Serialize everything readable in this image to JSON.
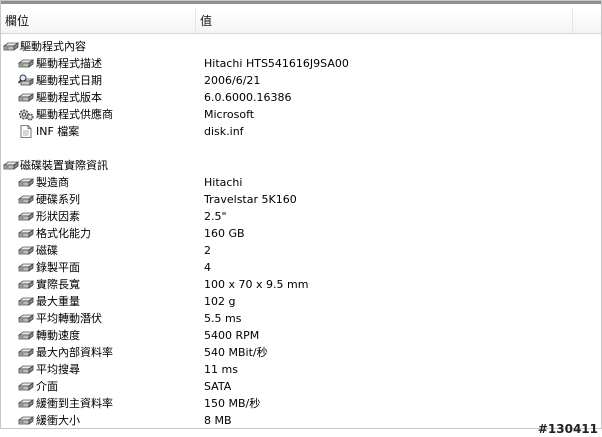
{
  "header": {
    "col_field": "欄位",
    "col_value": "值"
  },
  "sections": [
    {
      "title": "驅動程式內容",
      "icon": "drive-icon",
      "rows": [
        {
          "label": "驅動程式描述",
          "value": "Hitachi HTS541616J9SA00",
          "icon": "drive-icon"
        },
        {
          "label": "驅動程式日期",
          "value": "2006/6/21",
          "icon": "search-drive-icon"
        },
        {
          "label": "驅動程式版本",
          "value": "6.0.6000.16386",
          "icon": "drive-icon"
        },
        {
          "label": "驅動程式供應商",
          "value": "Microsoft",
          "icon": "gear-icon"
        },
        {
          "label": "INF 檔案",
          "value": "disk.inf",
          "icon": "document-icon"
        }
      ]
    },
    {
      "title": "磁碟裝置實際資訊",
      "icon": "drive-icon",
      "rows": [
        {
          "label": "製造商",
          "value": "Hitachi",
          "icon": "drive-icon"
        },
        {
          "label": "硬碟系列",
          "value": "Travelstar 5K160",
          "icon": "drive-icon"
        },
        {
          "label": "形狀因素",
          "value": "2.5\"",
          "icon": "drive-icon"
        },
        {
          "label": "格式化能力",
          "value": "160 GB",
          "icon": "drive-icon"
        },
        {
          "label": "磁碟",
          "value": "2",
          "icon": "drive-icon"
        },
        {
          "label": "錄製平面",
          "value": "4",
          "icon": "drive-icon"
        },
        {
          "label": "實際長寬",
          "value": "100 x 70 x 9.5 mm",
          "icon": "drive-icon"
        },
        {
          "label": "最大重量",
          "value": "102 g",
          "icon": "drive-icon"
        },
        {
          "label": "平均轉動潛伏",
          "value": "5.5 ms",
          "icon": "drive-icon"
        },
        {
          "label": "轉動速度",
          "value": "5400 RPM",
          "icon": "drive-icon"
        },
        {
          "label": "最大內部資料率",
          "value": "540 MBit/秒",
          "icon": "drive-icon"
        },
        {
          "label": "平均搜尋",
          "value": "11 ms",
          "icon": "drive-icon"
        },
        {
          "label": "介面",
          "value": "SATA",
          "icon": "drive-icon"
        },
        {
          "label": "緩衝到主資料率",
          "value": "150 MB/秒",
          "icon": "drive-icon"
        },
        {
          "label": "緩衝大小",
          "value": "8 MB",
          "icon": "drive-icon"
        }
      ]
    }
  ],
  "watermark": "#130411"
}
